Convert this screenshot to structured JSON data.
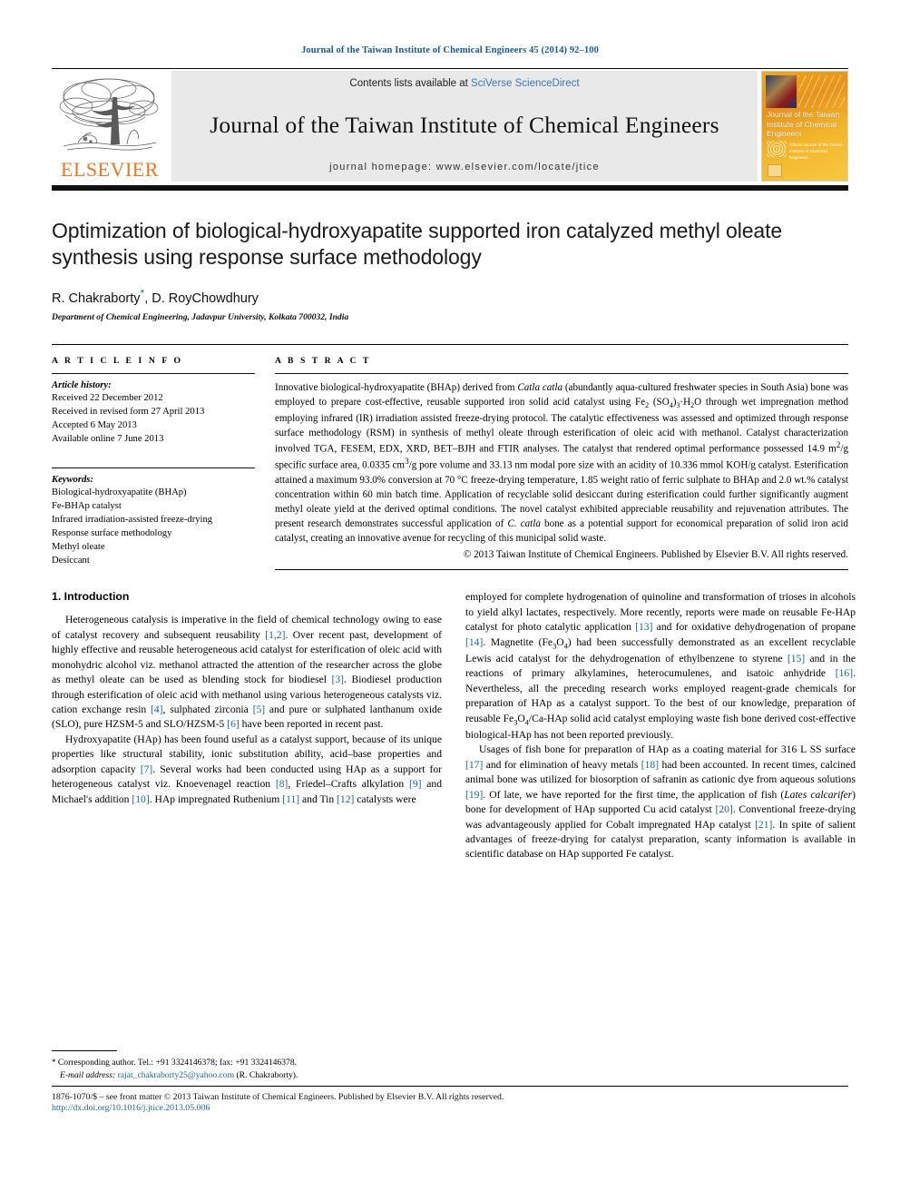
{
  "running_head": "Journal of the Taiwan Institute of Chemical Engineers 45 (2014) 92–100",
  "masthead": {
    "contents_prefix": "Contents lists available at ",
    "sciencedirect": "SciVerse ScienceDirect",
    "journal_title": "Journal of the Taiwan Institute of Chemical Engineers",
    "homepage": "journal homepage: www.elsevier.com/locate/jtice",
    "publisher_word": "ELSEVIER",
    "cover": {
      "title": "Journal of the Taiwan Institute of Chemical Engineers",
      "body_lines": "Official Journal of the Taiwan Institute of Chemical Engineers"
    }
  },
  "colors": {
    "link_blue": "#1a6496",
    "sciencedirect_blue": "#3a77b5",
    "elsevier_orange": "#E87722",
    "masthead_grey": "#e9e9e9"
  },
  "article": {
    "title": "Optimization of biological-hydroxyapatite supported iron catalyzed methyl oleate synthesis using response surface methodology",
    "authors": "R. Chakraborty",
    "corresponding_mark": "*",
    "authors_rest": ", D. RoyChowdhury",
    "affiliation": "Department of Chemical Engineering, Jadavpur University, Kolkata 700032, India"
  },
  "article_info": {
    "heading": "A R T I C L E   I N F O",
    "history_label": "Article history:",
    "history": [
      "Received 22 December 2012",
      "Received in revised form 27 April 2013",
      "Accepted 6 May 2013",
      "Available online 7 June 2013"
    ],
    "keywords_label": "Keywords:",
    "keywords": [
      "Biological-hydroxyapatite (BHAp)",
      "Fe-BHAp catalyst",
      "Infrared irradiation-assisted freeze-drying",
      "Response surface methodology",
      "Methyl oleate",
      "Desiccant"
    ]
  },
  "abstract": {
    "heading": "A B S T R A C T",
    "copyright": "© 2013 Taiwan Institute of Chemical Engineers. Published by Elsevier B.V. All rights reserved."
  },
  "introduction": {
    "section_number_title": "1. Introduction"
  },
  "footnote": {
    "star": "*",
    "corresponding": " Corresponding author. Tel.: +91 3324146378; fax: +91 3324146378.",
    "email_label": "E-mail address:",
    "email": "rajat_chakraborty25@yahoo.com",
    "email_suffix": " (R. Chakraborty)."
  },
  "bottom": {
    "issn_line": "1876-1070/$ – see front matter © 2013 Taiwan Institute of Chemical Engineers. Published by Elsevier B.V. All rights reserved.",
    "doi": "http://dx.doi.org/10.1016/j.jtice.2013.05.006"
  }
}
